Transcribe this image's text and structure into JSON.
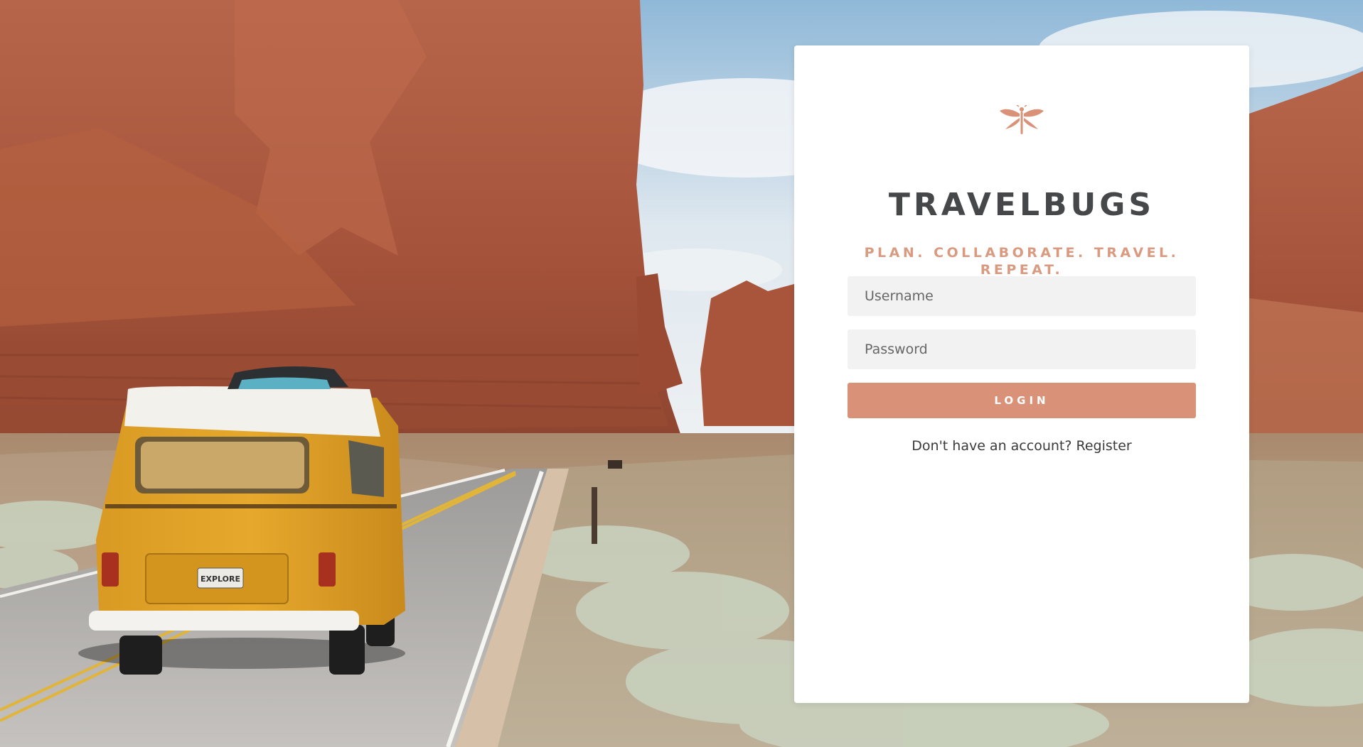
{
  "brand": {
    "name": "TRAVELBUGS",
    "tagline": "PLAN. COLLABORATE. TRAVEL. REPEAT.",
    "logo_icon": "dragonfly-icon",
    "accent_color": "#d99178"
  },
  "login_form": {
    "username_placeholder": "Username",
    "password_placeholder": "Password",
    "login_label": "LOGIN",
    "register_prompt": "Don't have an account?",
    "register_link": "Register"
  },
  "background": {
    "van_plate": "EXPLORE"
  }
}
